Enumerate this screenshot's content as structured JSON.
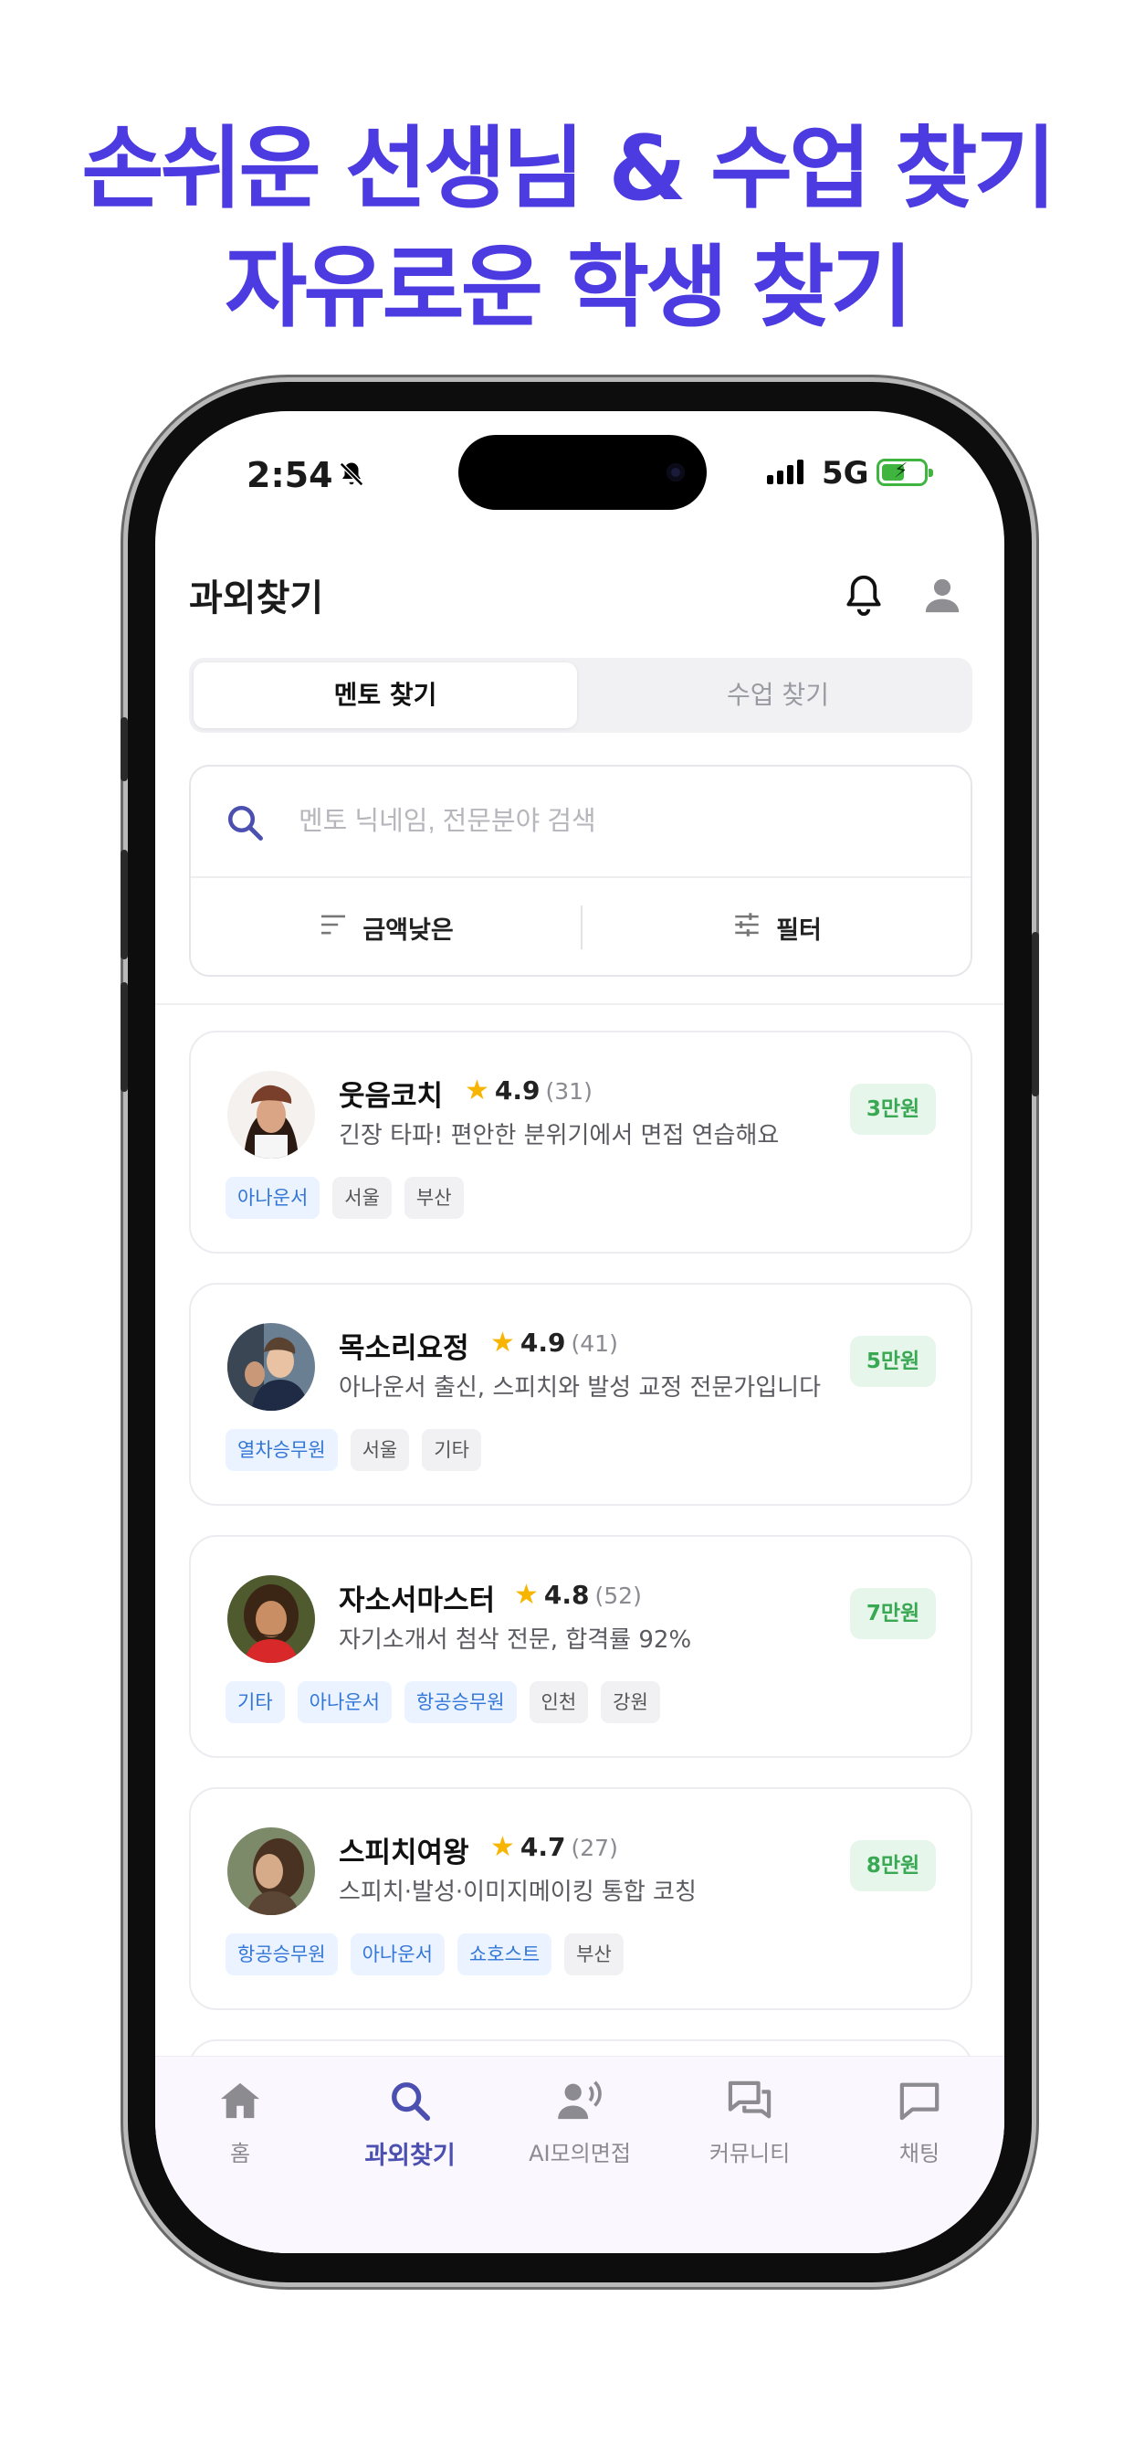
{
  "headline": {
    "line1": "손쉬운 선생님 & 수업 찾기",
    "line2": "자유로운 학생 찾기",
    "color": "#4b3be0"
  },
  "status_bar": {
    "time": "2:54",
    "network": "5G",
    "silent_icon": "bell-slash-icon",
    "charging": true
  },
  "app": {
    "title": "과외찾기",
    "header_icons": [
      "bell-icon",
      "user-icon"
    ],
    "tabs": [
      {
        "label": "멘토 찾기",
        "active": true
      },
      {
        "label": "수업 찾기",
        "active": false
      }
    ],
    "search": {
      "placeholder": "멘토 닉네임, 전문분야 검색"
    },
    "sort_label": "금액낮은",
    "filter_label": "필터"
  },
  "mentors": [
    {
      "name": "웃음코치",
      "rating": "4.9",
      "reviews": "(31)",
      "desc": "긴장 타파! 편안한 분위기에서 면접 연습해요",
      "price": "3만원",
      "tags": [
        {
          "label": "아나운서",
          "kind": "blue"
        },
        {
          "label": "서울",
          "kind": "gray"
        },
        {
          "label": "부산",
          "kind": "gray"
        }
      ]
    },
    {
      "name": "목소리요정",
      "rating": "4.9",
      "reviews": "(41)",
      "desc": "아나운서 출신, 스피치와 발성 교정 전문가입니다",
      "price": "5만원",
      "tags": [
        {
          "label": "열차승무원",
          "kind": "blue"
        },
        {
          "label": "서울",
          "kind": "gray"
        },
        {
          "label": "기타",
          "kind": "gray"
        }
      ]
    },
    {
      "name": "자소서마스터",
      "rating": "4.8",
      "reviews": "(52)",
      "desc": "자기소개서 첨삭 전문, 합격률 92%",
      "price": "7만원",
      "tags": [
        {
          "label": "기타",
          "kind": "blue"
        },
        {
          "label": "아나운서",
          "kind": "blue"
        },
        {
          "label": "항공승무원",
          "kind": "blue"
        },
        {
          "label": "인천",
          "kind": "gray"
        },
        {
          "label": "강원",
          "kind": "gray"
        }
      ]
    },
    {
      "name": "스피치여왕",
      "rating": "4.7",
      "reviews": "(27)",
      "desc": "스피치·발성·이미지메이킹 통합 코칭",
      "price": "8만원",
      "tags": [
        {
          "label": "항공승무원",
          "kind": "blue"
        },
        {
          "label": "아나운서",
          "kind": "blue"
        },
        {
          "label": "쇼호스트",
          "kind": "blue"
        },
        {
          "label": "부산",
          "kind": "gray"
        }
      ]
    }
  ],
  "bottom_nav": [
    {
      "label": "홈",
      "icon": "home-icon",
      "active": false
    },
    {
      "label": "과외찾기",
      "icon": "search-icon",
      "active": true
    },
    {
      "label": "AI모의면접",
      "icon": "voice-user-icon",
      "active": false
    },
    {
      "label": "커뮤니티",
      "icon": "chat-bubbles-icon",
      "active": false
    },
    {
      "label": "채팅",
      "icon": "chat-icon",
      "active": false
    }
  ],
  "colors": {
    "accent": "#4b3be0",
    "nav_active": "#4a4fb0",
    "price_green": "#38a852",
    "star": "#f7b500",
    "tag_blue": "#3276d8"
  }
}
